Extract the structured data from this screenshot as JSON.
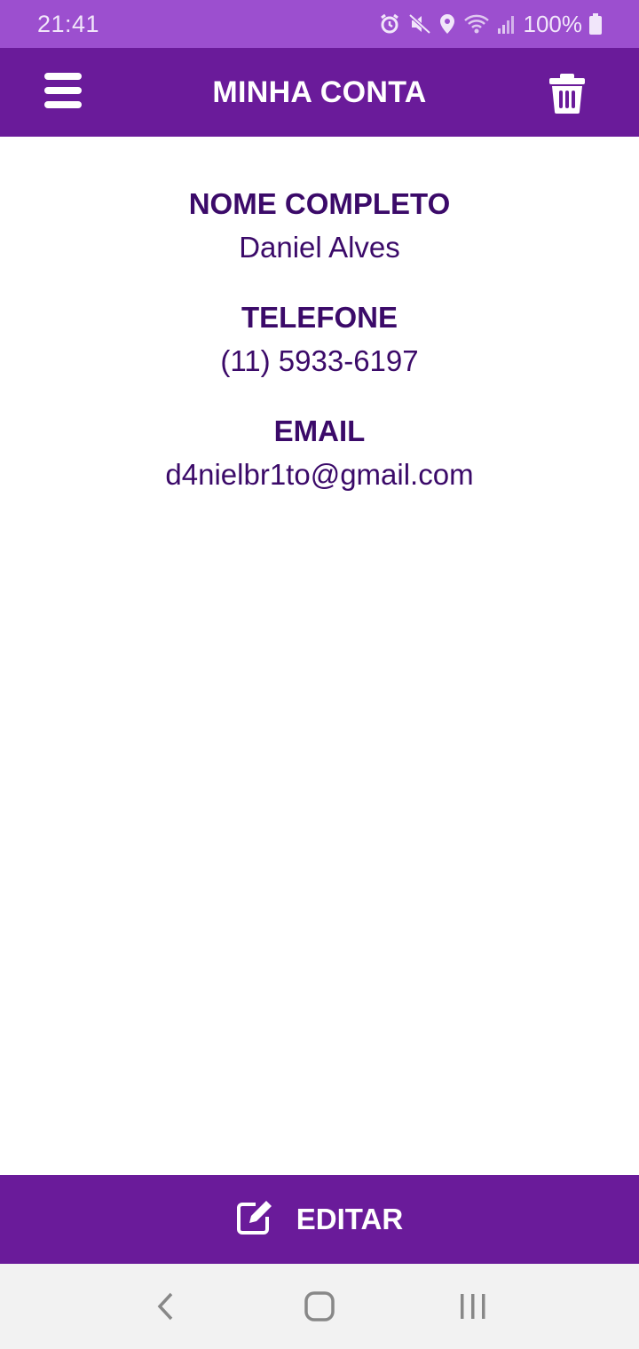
{
  "status_bar": {
    "time": "21:41",
    "battery": "100%",
    "icons": [
      "alarm-icon",
      "mute-icon",
      "location-icon",
      "wifi-icon",
      "signal-icon",
      "battery-icon"
    ]
  },
  "app_bar": {
    "title": "MINHA CONTA",
    "left_icon": "menu-icon",
    "right_icon": "trash-icon"
  },
  "profile": {
    "fields": [
      {
        "label": "NOME COMPLETO",
        "value": "Daniel Alves"
      },
      {
        "label": "TELEFONE",
        "value": "(11) 5933-6197"
      },
      {
        "label": "EMAIL",
        "value": "d4nielbr1to@gmail.com"
      }
    ]
  },
  "edit_button": {
    "label": "EDITAR",
    "icon": "edit-icon"
  },
  "colors": {
    "primary": "#6a1b9a",
    "status_bar": "#9c4fcf",
    "text": "#3b0a69",
    "nav_bar": "#f2f2f2"
  },
  "nav": {
    "icons": [
      "back-icon",
      "home-icon",
      "recents-icon"
    ]
  }
}
